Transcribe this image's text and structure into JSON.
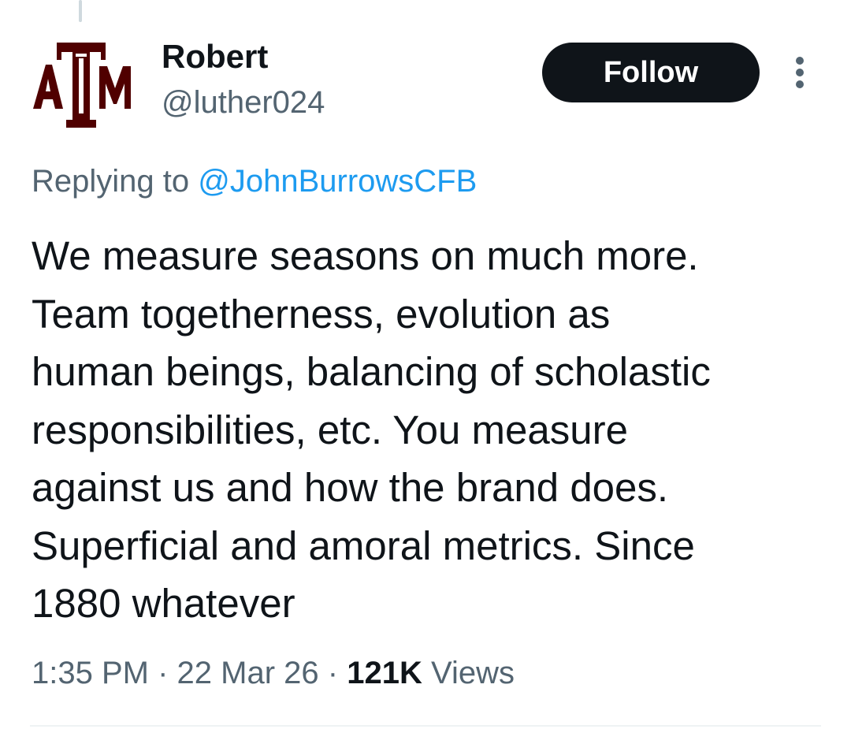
{
  "tweet": {
    "author": {
      "name": "Robert",
      "handle": "@luther024",
      "avatar_icon": "atm-logo-icon",
      "avatar_color": "#500000"
    },
    "follow_label": "Follow",
    "more_icon": "more-vertical-icon",
    "reply": {
      "prefix": "Replying to",
      "mention": "@JohnBurrowsCFB"
    },
    "text_lines": [
      "We measure seasons on much more.",
      "Team togetherness, evolution as",
      "human beings, balancing of scholastic",
      "responsibilities, etc. You measure",
      "against us and how the brand does.",
      "Superficial and amoral metrics. Since",
      "1880 whatever"
    ],
    "meta": {
      "time": "1:35 PM",
      "date": "22 Mar 26",
      "views_count": "121K",
      "views_label": "Views"
    }
  },
  "colors": {
    "text": "#0f1419",
    "secondary": "#536471",
    "link": "#1d9bf0",
    "button_bg": "#0f1419",
    "button_text": "#ffffff"
  }
}
